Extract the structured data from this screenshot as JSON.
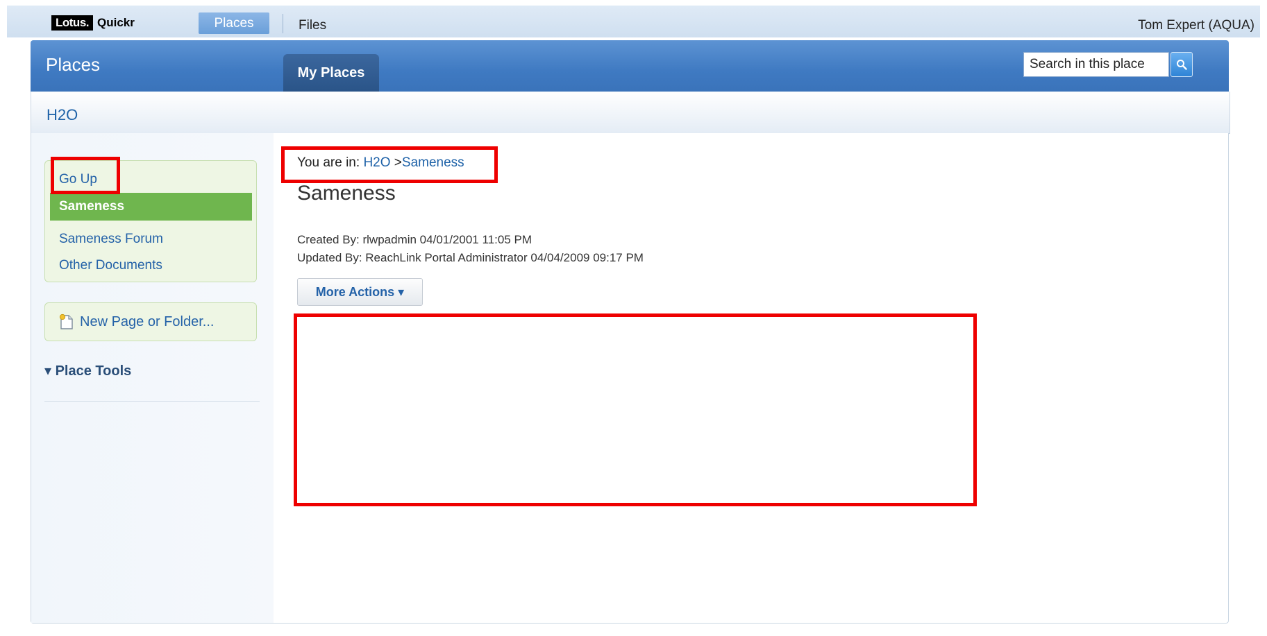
{
  "topbar": {
    "logo_lotus": "Lotus.",
    "logo_quickr": "Quickr",
    "tab_places": "Places",
    "tab_files": "Files",
    "user": "Tom Expert (AQUA)"
  },
  "banner": {
    "title": "Places",
    "tab_my_places": "My Places",
    "search_placeholder": "Search in this place"
  },
  "place": {
    "name": "H2O"
  },
  "sidebar": {
    "go_up": "Go Up",
    "selected": "Sameness",
    "items": [
      "Sameness Forum",
      "Other Documents"
    ],
    "new_page": "New Page or Folder...",
    "place_tools": "▾ Place Tools"
  },
  "content": {
    "breadcrumb_prefix": "You are in:",
    "breadcrumb_h2o": "H2O",
    "breadcrumb_sep": ">",
    "breadcrumb_page": "Sameness",
    "title": "Sameness",
    "created_by": "Created By:  rlwpadmin  04/01/2001 11:05 PM",
    "updated_by": "Updated By:  ReachLink Portal Administrator  04/04/2009 09:17 PM",
    "more_actions": "More Actions ▾"
  },
  "colors": {
    "accent_blue": "#3f7ac2",
    "selected_green": "#6fb64e",
    "annotation_red": "#ee0000"
  }
}
